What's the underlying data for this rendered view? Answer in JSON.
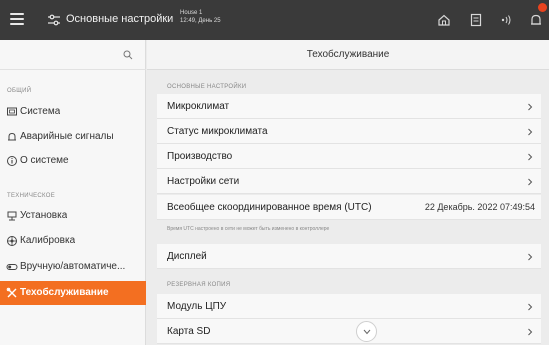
{
  "topbar": {
    "title": "Основные настройки",
    "house_name": "House 1",
    "house_time": "12:49, День 25"
  },
  "sidebar": {
    "section_general": "ОБЩИЙ",
    "section_technical": "ТЕХНИЧЕСКОЕ",
    "items": [
      {
        "label": "Система",
        "icon": "monitor-icon"
      },
      {
        "label": "Аварийные сигналы",
        "icon": "bell-icon"
      },
      {
        "label": "О системе",
        "icon": "info-icon"
      },
      {
        "label": "Установка",
        "icon": "install-icon"
      },
      {
        "label": "Калибровка",
        "icon": "calibration-icon"
      },
      {
        "label": "Вручную/автоматиче...",
        "icon": "toggle-icon"
      },
      {
        "label": "Техобслуживание",
        "icon": "wrench-icon",
        "active": true
      }
    ]
  },
  "main": {
    "title": "Техобслуживание",
    "section_basic": "ОСНОВНЫЕ НАСТРОЙКИ",
    "section_backup": "РЕЗЕРВНАЯ КОПИЯ",
    "rows": [
      {
        "label": "Микроклимат"
      },
      {
        "label": "Статус микроклимата"
      },
      {
        "label": "Производство"
      },
      {
        "label": "Настройки сети"
      },
      {
        "label": "Всеобщее скоординированное время (UTC)",
        "value": "22 Декабрь. 2022 07:49:54"
      },
      {
        "label": "Дисплей"
      },
      {
        "label": "Модуль ЦПУ"
      },
      {
        "label": "Карта SD"
      }
    ],
    "utc_note": "Время UTC настроено в сети не может быть изменено в контроллере"
  },
  "colors": {
    "accent": "#f36f21",
    "topbar": "#3a3a3a",
    "badge": "#e8431e"
  }
}
